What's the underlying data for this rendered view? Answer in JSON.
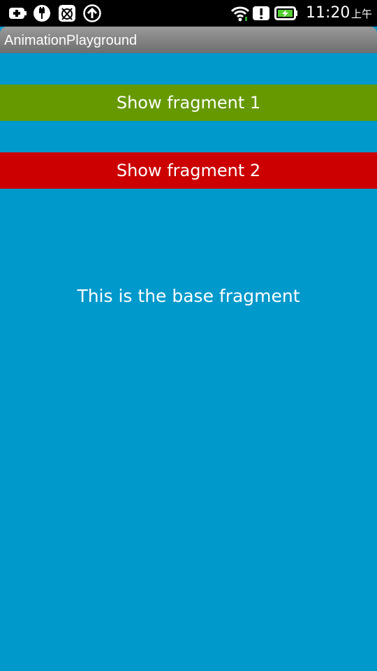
{
  "status_bar": {
    "icons": [
      "battery-saver-icon",
      "usb-icon",
      "debug-icon",
      "upload-icon",
      "wifi-icon",
      "alert-icon",
      "battery-charging-icon"
    ],
    "time": "11:20",
    "ampm": "上午"
  },
  "app": {
    "title": "AnimationPlayground"
  },
  "main": {
    "button_1_label": "Show fragment 1",
    "button_2_label": "Show fragment 2",
    "base_text": "This is the base fragment"
  },
  "colors": {
    "background": "#0099cc",
    "button_1": "#669900",
    "button_2": "#cc0000",
    "status_bar": "#000000"
  }
}
